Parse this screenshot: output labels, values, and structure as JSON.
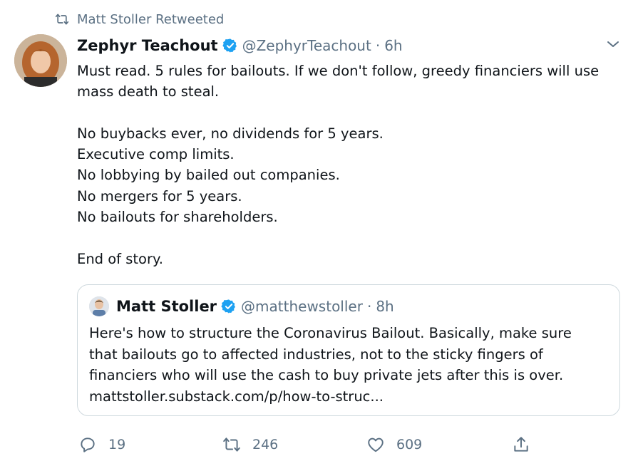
{
  "retweet": {
    "text": "Matt Stoller Retweeted"
  },
  "tweet": {
    "name": "Zephyr Teachout",
    "handle": "@ZephyrTeachout",
    "separator": "·",
    "time": "6h",
    "lines": [
      "Must read. 5 rules for bailouts. If we don't follow, greedy financiers will use",
      "mass death to steal.",
      "",
      "No buybacks ever, no dividends for 5 years.",
      "Executive comp limits.",
      "No lobbying by bailed out companies.",
      "No mergers for 5 years.",
      "No bailouts for shareholders.",
      "",
      "End of story."
    ]
  },
  "quoted": {
    "name": "Matt Stoller",
    "handle": "@matthewstoller",
    "separator": "·",
    "time": "8h",
    "lines": [
      "Here's how to structure the Coronavirus Bailout. Basically, make sure",
      "that bailouts go to affected industries, not to the sticky fingers of",
      "financiers who will use the cash to buy private jets after this is over.",
      "mattstoller.substack.com/p/how-to-struc..."
    ]
  },
  "actions": {
    "replies": "19",
    "retweets": "246",
    "likes": "609"
  },
  "colors": {
    "verified": "#1da1f2",
    "muted": "#5b7083",
    "border": "#cfd9de"
  }
}
